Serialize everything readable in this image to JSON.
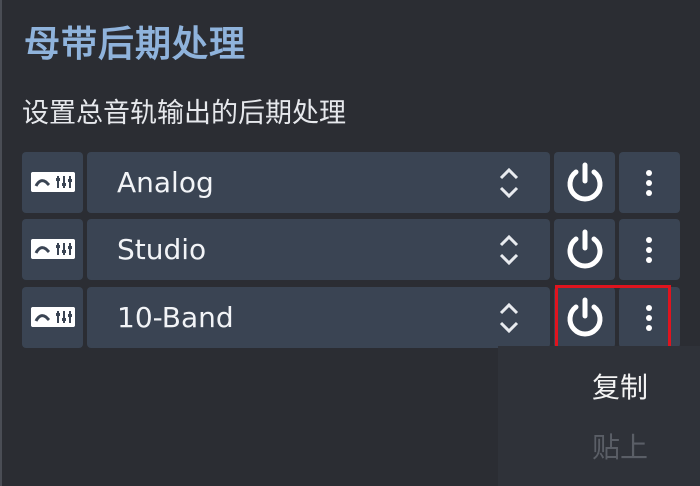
{
  "panel": {
    "title": "母带后期处理",
    "subtitle": "设置总音轨输出的后期处理"
  },
  "rows": [
    {
      "label": "Analog",
      "icon": "equalizer-icon",
      "power_icon": "power-icon",
      "menu_icon": "kebab-menu-icon"
    },
    {
      "label": "Studio",
      "icon": "equalizer-icon",
      "power_icon": "power-icon",
      "menu_icon": "kebab-menu-icon"
    },
    {
      "label": "10-Band",
      "icon": "equalizer-icon",
      "power_icon": "power-icon",
      "menu_icon": "kebab-menu-icon",
      "highlighted": true
    }
  ],
  "context_menu": {
    "copy": "复制",
    "paste": "贴上",
    "paste_disabled": true
  },
  "colors": {
    "background": "#2b2d33",
    "row_cell": "#3a4453",
    "title": "#8fb3dc",
    "highlight": "#e0141e",
    "menu_bg": "#2f3239",
    "disabled_text": "#5a5e66"
  }
}
